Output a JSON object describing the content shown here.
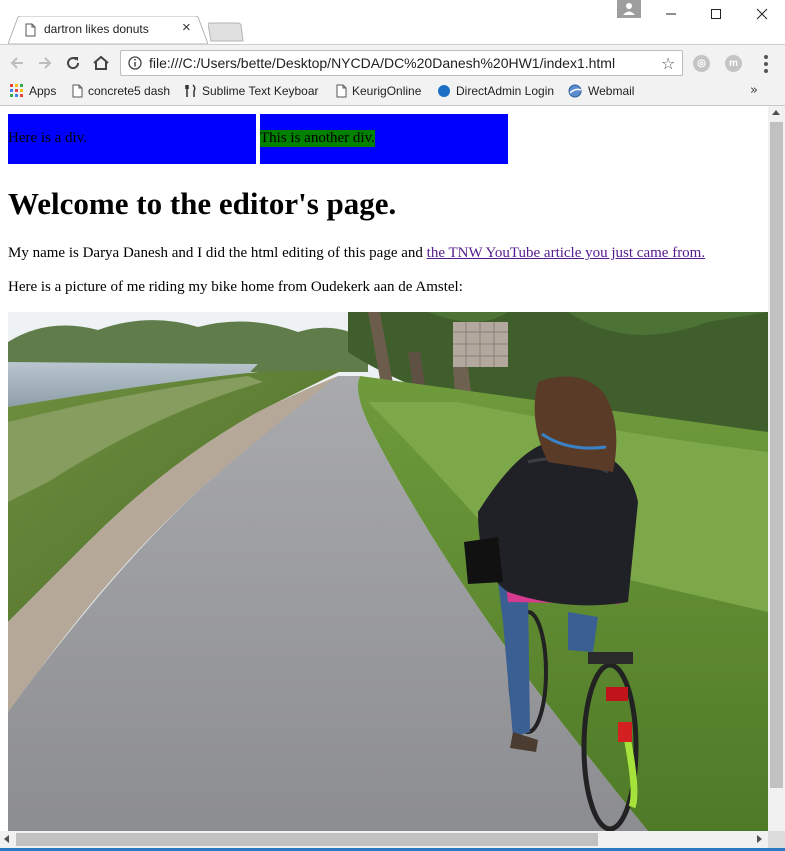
{
  "browser": {
    "tab": {
      "title": "dartron likes donuts",
      "close": "×"
    },
    "window_controls": {
      "minimize": "—",
      "maximize": "☐",
      "close": "✕"
    },
    "address": {
      "url": "file:///C:/Users/bette/Desktop/NYCDA/DC%20Danesh%20HW1/index1.html",
      "star": "☆"
    },
    "extensions": [
      {
        "icon": "extension-a-icon",
        "letter": "◎"
      },
      {
        "icon": "extension-m-icon",
        "letter": "m"
      }
    ],
    "bookmarks": [
      {
        "label": "Apps",
        "icon": "apps-grid-icon"
      },
      {
        "label": "concrete5 dash",
        "icon": "page-icon"
      },
      {
        "label": "Sublime Text Keyboar",
        "icon": "fork-knife-icon"
      },
      {
        "label": "KeurigOnline",
        "icon": "page-icon"
      },
      {
        "label": "DirectAdmin Login",
        "icon": "blue-circle-icon"
      },
      {
        "label": "Webmail",
        "icon": "webmail-icon"
      }
    ],
    "bookmarks_more": "»"
  },
  "page": {
    "div1": "Here is a div.",
    "div2": "This is another div.",
    "heading": "Welcome to the editor's page.",
    "intro_text": "My name is Darya Danesh and I did the html editing of this page and ",
    "link_text": "the TNW YouTube article you just came from.",
    "picture_caption": "Here is a picture of me riding my bike home from Oudekerk aan de Amstel:"
  },
  "colors": {
    "div_background": "#0000ff",
    "highlight_background": "#008000",
    "visited_link": "#551a8b",
    "page_background": "#ffffff"
  }
}
